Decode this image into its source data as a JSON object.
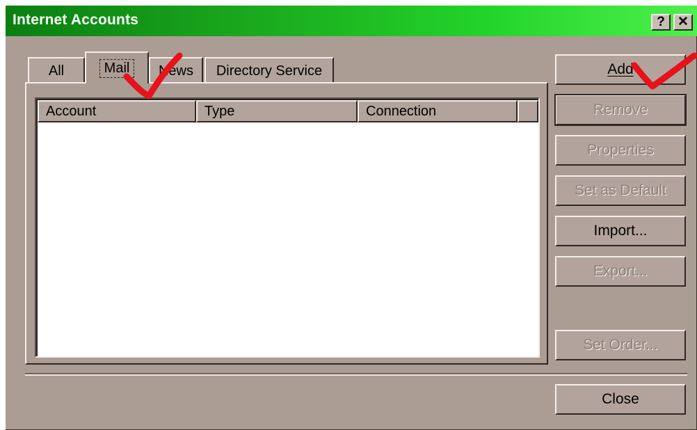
{
  "window": {
    "title": "Internet Accounts",
    "help_glyph": "?",
    "close_glyph": "✕"
  },
  "tabs": [
    {
      "label": "All"
    },
    {
      "label": "Mail",
      "selected": true
    },
    {
      "label": "News"
    },
    {
      "label": "Directory Service"
    }
  ],
  "list": {
    "columns": [
      "Account",
      "Type",
      "Connection"
    ],
    "rows": []
  },
  "buttons": {
    "add": "Add",
    "remove": "Remove",
    "properties": "Properties",
    "set_default": "Set as Default",
    "import": "Import...",
    "export": "Export...",
    "set_order": "Set Order...",
    "close": "Close"
  },
  "annotations": {
    "checkmark_color": "#e8121a",
    "checkmark_icon": "hand-drawn-checkmark"
  },
  "colors": {
    "titlebar_start": "#0a7f12",
    "titlebar_end": "#4ef04c",
    "dialog_face": "#ab9c94"
  }
}
